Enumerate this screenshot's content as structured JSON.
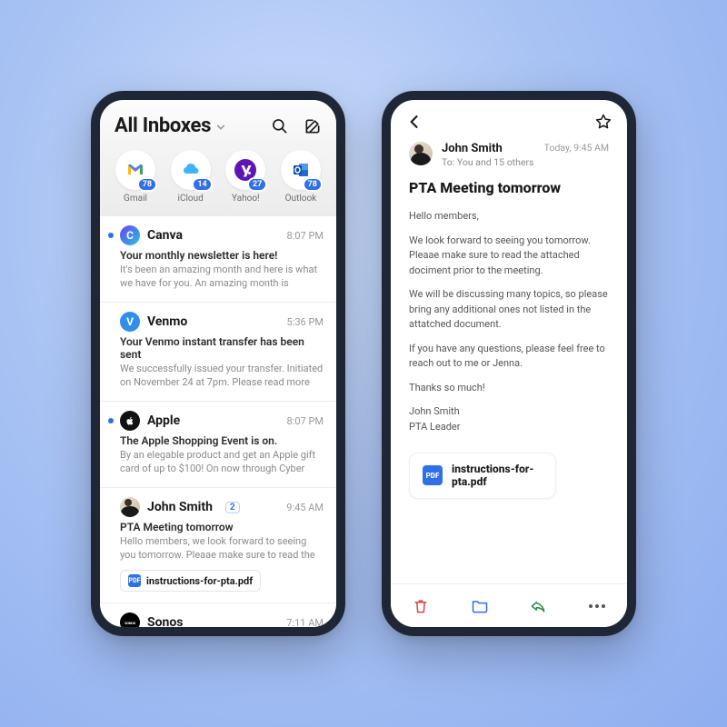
{
  "header": {
    "title": "All Inboxes"
  },
  "accounts": [
    {
      "name": "Gmail",
      "badge": 78,
      "icon": "gmail"
    },
    {
      "name": "iCloud",
      "badge": 14,
      "icon": "icloud"
    },
    {
      "name": "Yahoo!",
      "badge": 27,
      "icon": "yahoo"
    },
    {
      "name": "Outlook",
      "badge": 78,
      "icon": "outlook"
    }
  ],
  "emails": [
    {
      "sender": "Canva",
      "time": "8:07 PM",
      "unread": true,
      "avatar": {
        "bg": "linear-gradient(135deg,#6c3ef7,#25c6e0)",
        "text": "C"
      },
      "subject": "Your monthly newsletter is here!",
      "preview": "It's been an amazing month and here is what we have for you. An amazing month is upcom..."
    },
    {
      "sender": "Venmo",
      "time": "5:36 PM",
      "unread": false,
      "avatar": {
        "bg": "#2f8fe8",
        "text": "V"
      },
      "subject": "Your Venmo instant transfer has been sent",
      "preview": "We successfully issued your transfer. Initiated on November 24 at 7pm. Please read more he..."
    },
    {
      "sender": "Apple",
      "time": "8:07 PM",
      "unread": true,
      "avatar": {
        "bg": "#111",
        "text": "",
        "apple": true
      },
      "subject": "The Apple Shopping Event is on.",
      "preview": "By an elegable product and get an Apple gift card of up to $100! On now through Cyber Mo..."
    },
    {
      "sender": "John Smith",
      "time": "9:45 AM",
      "unread": false,
      "thread": 2,
      "avatar": {
        "bg": "person",
        "text": ""
      },
      "subject": "PTA Meeting tomorrow",
      "preview": "Hello members, we look forward to seeing you tomorrow. Pleaae make sure to read the attac...",
      "attachment": "instructions-for-pta.pdf"
    },
    {
      "sender": "Sonos",
      "time": "7:11 AM",
      "unread": false,
      "avatar": {
        "bg": "#000",
        "text": "SONOS",
        "tiny": true
      }
    }
  ],
  "detail": {
    "from": "John Smith",
    "time": "Today, 9:45 AM",
    "to": "To: You and 15 others",
    "subject": "PTA Meeting tomorrow",
    "body": [
      "Hello members,",
      "We look forward to seeing you tomorrow. Pleaae make sure to read the attached dociment prior to the meeting.",
      "We will be discussing many topics, so please bring any additional ones not listed in the attatched document.",
      "If you have any questions, please feel free to reach out to me or Jenna.",
      "Thanks so much!",
      "John Smith\nPTA Leader"
    ],
    "attachment": "instructions-for-pta.pdf"
  },
  "pdf_label": "PDF"
}
